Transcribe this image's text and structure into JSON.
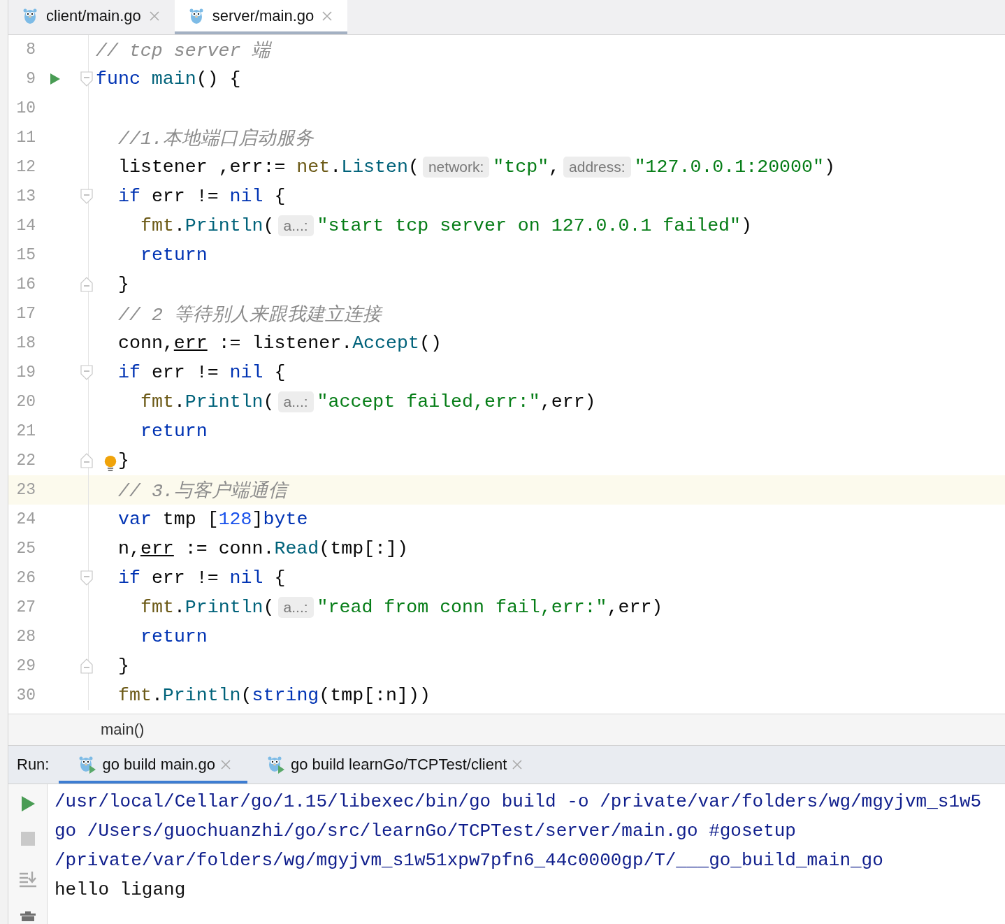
{
  "editor_tabs": [
    {
      "label": "client/main.go",
      "selected": false
    },
    {
      "label": "server/main.go",
      "selected": true
    }
  ],
  "editor": {
    "lines": [
      {
        "number": "8",
        "current": false,
        "tokens": [
          {
            "kind": "comment",
            "text": "// tcp server 端"
          }
        ]
      },
      {
        "number": "9",
        "current": false,
        "gutter_mark": {
          "kind": "run"
        },
        "fold_mark": {
          "kind": "open"
        },
        "tokens": [
          {
            "kind": "keyword",
            "text": "func "
          },
          {
            "kind": "function",
            "text": "main"
          },
          {
            "kind": "plain",
            "text": "() {"
          }
        ],
        "children": [
          {
            "number": "10",
            "current": false
          },
          {
            "number": "11",
            "current": false,
            "tokens": [
              {
                "kind": "comment",
                "text": "//1.本地端口启动服务"
              }
            ]
          },
          {
            "number": "12",
            "current": false,
            "tokens": [
              {
                "kind": "plain",
                "text": "listener ,err:= "
              },
              {
                "kind": "package",
                "text": "net"
              },
              {
                "kind": "plain",
                "text": "."
              },
              {
                "kind": "function",
                "text": "Listen"
              },
              {
                "kind": "plain",
                "text": "("
              },
              {
                "kind": "hint",
                "text": "network:"
              },
              {
                "kind": "string",
                "text": "\"tcp\""
              },
              {
                "kind": "plain",
                "text": ","
              },
              {
                "kind": "hint",
                "text": "address:"
              },
              {
                "kind": "string",
                "text": "\"127.0.0.1:20000\""
              },
              {
                "kind": "plain",
                "text": ")"
              }
            ]
          },
          {
            "number": "13",
            "current": false,
            "fold_mark": {
              "kind": "open"
            },
            "tokens": [
              {
                "kind": "keyword",
                "text": "if"
              },
              {
                "kind": "plain",
                "text": " err != "
              },
              {
                "kind": "keyword",
                "text": "nil"
              },
              {
                "kind": "plain",
                "text": " {"
              }
            ],
            "children": [
              {
                "number": "14",
                "current": false,
                "tokens": [
                  {
                    "kind": "package",
                    "text": "fmt"
                  },
                  {
                    "kind": "plain",
                    "text": "."
                  },
                  {
                    "kind": "function",
                    "text": "Println"
                  },
                  {
                    "kind": "plain",
                    "text": "("
                  },
                  {
                    "kind": "hint",
                    "text": "a...:"
                  },
                  {
                    "kind": "string",
                    "text": "\"start tcp server on 127.0.0.1 failed\""
                  },
                  {
                    "kind": "plain",
                    "text": ")"
                  }
                ]
              },
              {
                "number": "15",
                "current": false,
                "tokens": [
                  {
                    "kind": "keyword",
                    "text": "return"
                  }
                ]
              }
            ]
          },
          {
            "number": "16",
            "current": false,
            "fold_mark": {
              "kind": "close"
            },
            "tokens": [
              {
                "kind": "plain",
                "text": "}"
              }
            ]
          },
          {
            "number": "17",
            "current": false,
            "tokens": [
              {
                "kind": "comment",
                "text": "// 2 等待别人来跟我建立连接"
              }
            ]
          },
          {
            "number": "18",
            "current": false,
            "tokens": [
              {
                "kind": "plain",
                "text": "conn,"
              },
              {
                "kind": "underlined",
                "text": "err"
              },
              {
                "kind": "plain",
                "text": " := listener."
              },
              {
                "kind": "function",
                "text": "Accept"
              },
              {
                "kind": "plain",
                "text": "()"
              }
            ]
          },
          {
            "number": "19",
            "current": false,
            "fold_mark": {
              "kind": "open"
            },
            "tokens": [
              {
                "kind": "keyword",
                "text": "if"
              },
              {
                "kind": "plain",
                "text": " err != "
              },
              {
                "kind": "keyword",
                "text": "nil"
              },
              {
                "kind": "plain",
                "text": " {"
              }
            ],
            "children": [
              {
                "number": "20",
                "current": false,
                "tokens": [
                  {
                    "kind": "package",
                    "text": "fmt"
                  },
                  {
                    "kind": "plain",
                    "text": "."
                  },
                  {
                    "kind": "function",
                    "text": "Println"
                  },
                  {
                    "kind": "plain",
                    "text": "("
                  },
                  {
                    "kind": "hint",
                    "text": "a...:"
                  },
                  {
                    "kind": "string",
                    "text": "\"accept failed,err:\""
                  },
                  {
                    "kind": "plain",
                    "text": ",err)"
                  }
                ]
              },
              {
                "number": "21",
                "current": false,
                "tokens": [
                  {
                    "kind": "keyword",
                    "text": "return"
                  }
                ]
              }
            ]
          },
          {
            "number": "22",
            "current": false,
            "fold_mark": {
              "kind": "close"
            },
            "gutter_mark": {
              "kind": "bulb"
            },
            "tokens": [
              {
                "kind": "plain",
                "text": "}"
              }
            ]
          },
          {
            "number": "23",
            "current": true,
            "tokens": [
              {
                "kind": "comment",
                "text": "// 3.与客户端通信"
              }
            ]
          },
          {
            "number": "24",
            "current": false,
            "tokens": [
              {
                "kind": "keyword",
                "text": "var"
              },
              {
                "kind": "plain",
                "text": " tmp ["
              },
              {
                "kind": "number",
                "text": "128"
              },
              {
                "kind": "plain",
                "text": "]"
              },
              {
                "kind": "keyword",
                "text": "byte"
              }
            ]
          },
          {
            "number": "25",
            "current": false,
            "tokens": [
              {
                "kind": "plain",
                "text": "n,"
              },
              {
                "kind": "underlined",
                "text": "err"
              },
              {
                "kind": "plain",
                "text": " := conn."
              },
              {
                "kind": "function",
                "text": "Read"
              },
              {
                "kind": "plain",
                "text": "(tmp[:])"
              }
            ]
          },
          {
            "number": "26",
            "current": false,
            "fold_mark": {
              "kind": "open"
            },
            "tokens": [
              {
                "kind": "keyword",
                "text": "if"
              },
              {
                "kind": "plain",
                "text": " err != "
              },
              {
                "kind": "keyword",
                "text": "nil"
              },
              {
                "kind": "plain",
                "text": " {"
              }
            ],
            "children": [
              {
                "number": "27",
                "current": false,
                "tokens": [
                  {
                    "kind": "package",
                    "text": "fmt"
                  },
                  {
                    "kind": "plain",
                    "text": "."
                  },
                  {
                    "kind": "function",
                    "text": "Println"
                  },
                  {
                    "kind": "plain",
                    "text": "("
                  },
                  {
                    "kind": "hint",
                    "text": "a...:"
                  },
                  {
                    "kind": "string",
                    "text": "\"read from conn fail,err:\""
                  },
                  {
                    "kind": "plain",
                    "text": ",err)"
                  }
                ]
              },
              {
                "number": "28",
                "current": false,
                "tokens": [
                  {
                    "kind": "keyword",
                    "text": "return"
                  }
                ]
              }
            ]
          },
          {
            "number": "29",
            "current": false,
            "fold_mark": {
              "kind": "close"
            },
            "tokens": [
              {
                "kind": "plain",
                "text": "}"
              }
            ]
          },
          {
            "number": "30",
            "current": false,
            "tokens": [
              {
                "kind": "package",
                "text": "fmt"
              },
              {
                "kind": "plain",
                "text": "."
              },
              {
                "kind": "function",
                "text": "Println"
              },
              {
                "kind": "plain",
                "text": "("
              },
              {
                "kind": "keyword",
                "text": "string"
              },
              {
                "kind": "plain",
                "text": "(tmp[:n]))"
              }
            ]
          }
        ]
      }
    ]
  },
  "breadcrumb": "main()",
  "run_panel": {
    "label": "Run:",
    "tabs": [
      {
        "label": "go build main.go",
        "selected": true
      },
      {
        "label": "go build learnGo/TCPTest/client",
        "selected": false
      }
    ],
    "console": [
      {
        "kind": "command",
        "text": "/usr/local/Cellar/go/1.15/libexec/bin/go build -o /private/var/folders/wg/mgyjvm_s1w5"
      },
      {
        "kind": "command",
        "text": "go /Users/guochuanzhi/go/src/learnGo/TCPTest/server/main.go #gosetup"
      },
      {
        "kind": "command",
        "text": "/private/var/folders/wg/mgyjvm_s1w51xpw7pfn6_44c0000gp/T/___go_build_main_go"
      },
      {
        "kind": "output",
        "text": "hello ligang"
      }
    ]
  }
}
